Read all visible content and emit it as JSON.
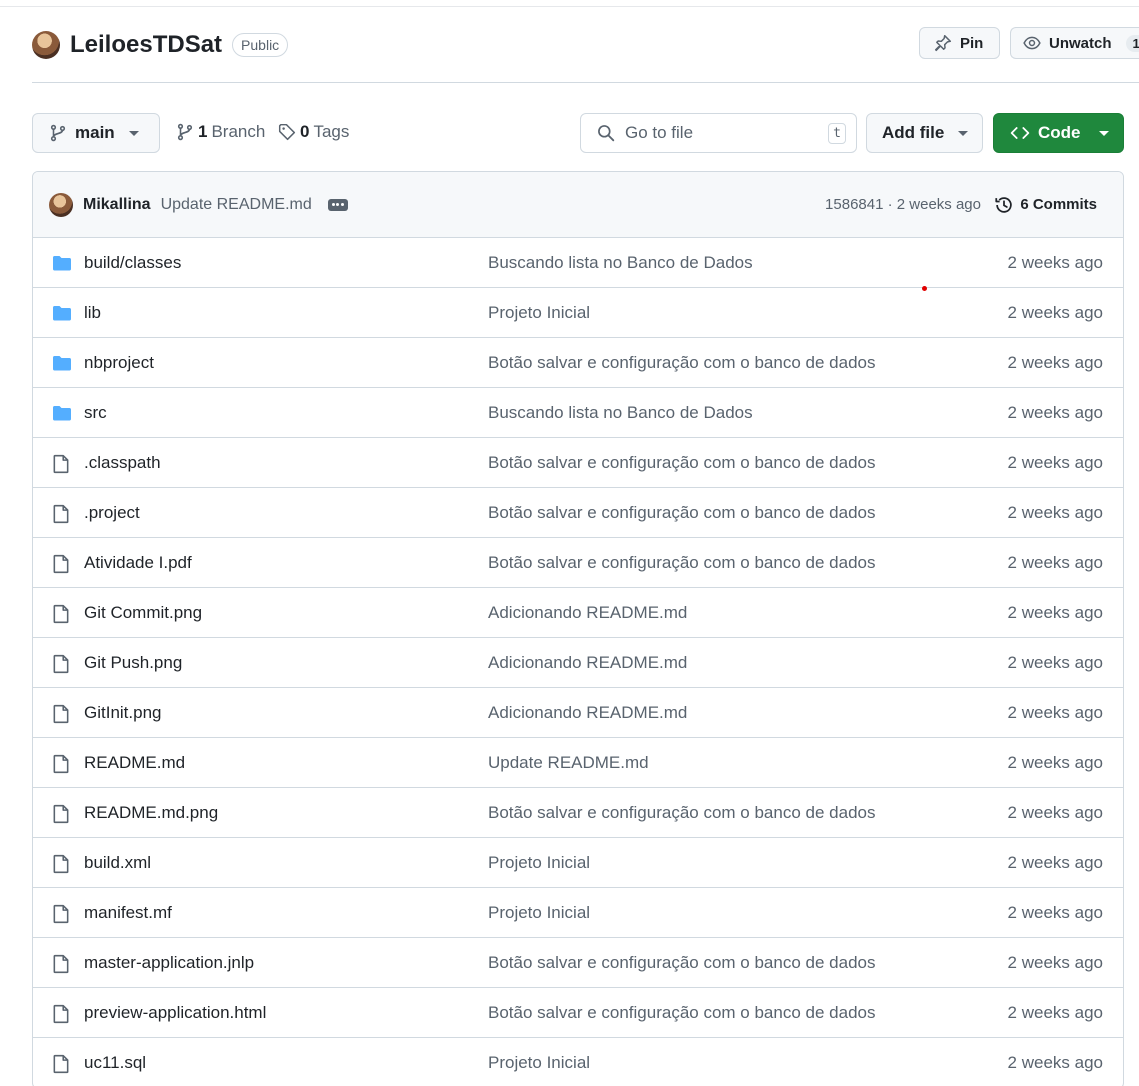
{
  "repo": {
    "name": "LeiloesTDSat",
    "visibility": "Public",
    "pin_label": "Pin",
    "unwatch_label": "Unwatch",
    "watch_count": "1"
  },
  "toolbar": {
    "branch": "main",
    "branch_count": "1",
    "branch_label": "Branch",
    "tag_count": "0",
    "tag_label": "Tags",
    "goto_placeholder": "Go to file",
    "goto_shortcut": "t",
    "addfile_label": "Add file",
    "code_label": "Code"
  },
  "latest_commit": {
    "author": "Mikallina",
    "message": "Update README.md",
    "meta": "1586841 · 2 weeks ago",
    "commits_label": "6 Commits"
  },
  "files": [
    {
      "name": "build/classes",
      "type": "folder",
      "message": "Buscando lista no Banco de Dados",
      "age": "2 weeks ago"
    },
    {
      "name": "lib",
      "type": "folder",
      "message": "Projeto Inicial",
      "age": "2 weeks ago"
    },
    {
      "name": "nbproject",
      "type": "folder",
      "message": "Botão salvar e configuração com o banco de dados",
      "age": "2 weeks ago"
    },
    {
      "name": "src",
      "type": "folder",
      "message": "Buscando lista no Banco de Dados",
      "age": "2 weeks ago"
    },
    {
      "name": ".classpath",
      "type": "file",
      "message": "Botão salvar e configuração com o banco de dados",
      "age": "2 weeks ago"
    },
    {
      "name": ".project",
      "type": "file",
      "message": "Botão salvar e configuração com o banco de dados",
      "age": "2 weeks ago"
    },
    {
      "name": "Atividade I.pdf",
      "type": "file",
      "message": "Botão salvar e configuração com o banco de dados",
      "age": "2 weeks ago"
    },
    {
      "name": "Git Commit.png",
      "type": "file",
      "message": "Adicionando README.md",
      "age": "2 weeks ago"
    },
    {
      "name": "Git Push.png",
      "type": "file",
      "message": "Adicionando README.md",
      "age": "2 weeks ago"
    },
    {
      "name": "GitInit.png",
      "type": "file",
      "message": "Adicionando README.md",
      "age": "2 weeks ago"
    },
    {
      "name": "README.md",
      "type": "file",
      "message": "Update README.md",
      "age": "2 weeks ago"
    },
    {
      "name": "README.md.png",
      "type": "file",
      "message": "Botão salvar e configuração com o banco de dados",
      "age": "2 weeks ago"
    },
    {
      "name": "build.xml",
      "type": "file",
      "message": "Projeto Inicial",
      "age": "2 weeks ago"
    },
    {
      "name": "manifest.mf",
      "type": "file",
      "message": "Projeto Inicial",
      "age": "2 weeks ago"
    },
    {
      "name": "master-application.jnlp",
      "type": "file",
      "message": "Botão salvar e configuração com o banco de dados",
      "age": "2 weeks ago"
    },
    {
      "name": "preview-application.html",
      "type": "file",
      "message": "Botão salvar e configuração com o banco de dados",
      "age": "2 weeks ago"
    },
    {
      "name": "uc11.sql",
      "type": "file",
      "message": "Projeto Inicial",
      "age": "2 weeks ago"
    }
  ],
  "colors": {
    "accent_green": "#1f883d",
    "folder_blue": "#54aeff",
    "muted_text": "#59636e",
    "border": "#d1d9e0"
  }
}
